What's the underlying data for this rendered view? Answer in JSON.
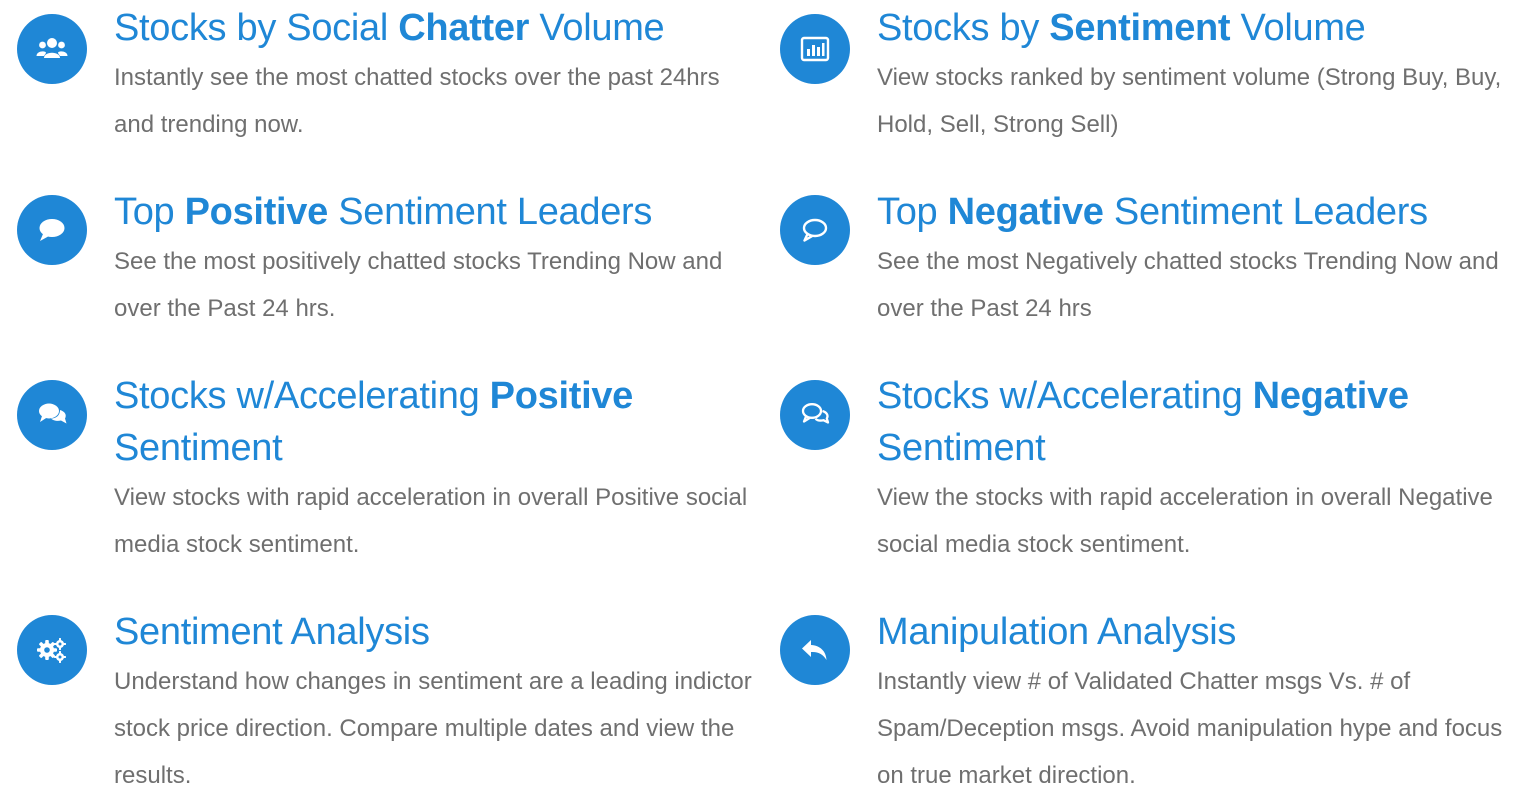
{
  "colors": {
    "accent": "#1f87d6",
    "body_text": "#6f6f6f"
  },
  "features": [
    {
      "icon": "users-icon",
      "title_pre": "Stocks by Social ",
      "title_bold": "Chatter",
      "title_post": " Volume",
      "description": "Instantly see the most chatted stocks over the past 24hrs and trending now."
    },
    {
      "icon": "bar-chart-icon",
      "title_pre": "Stocks by ",
      "title_bold": "Sentiment",
      "title_post": " Volume",
      "description": "View stocks ranked by sentiment volume (Strong Buy, Buy, Hold, Sell, Strong Sell)"
    },
    {
      "icon": "comment-icon",
      "title_pre": "Top ",
      "title_bold": "Positive",
      "title_post": " Sentiment Leaders",
      "description": "See the most positively chatted stocks Trending Now and over the Past 24 hrs."
    },
    {
      "icon": "comment-outline-icon",
      "title_pre": "Top ",
      "title_bold": "Negative",
      "title_post": " Sentiment Leaders",
      "description": "See the most Negatively chatted stocks Trending Now and over the Past 24 hrs"
    },
    {
      "icon": "comments-icon",
      "title_pre": "Stocks w/Accelerating ",
      "title_bold": "Positive",
      "title_post": " Sentiment",
      "description": "View stocks with rapid acceleration in overall Positive social media stock sentiment."
    },
    {
      "icon": "comments-outline-icon",
      "title_pre": "Stocks w/Accelerating ",
      "title_bold": "Negative",
      "title_post": " Sentiment",
      "description": "View the stocks with rapid acceleration in overall Negative social media stock sentiment."
    },
    {
      "icon": "gears-icon",
      "title_pre": "Sentiment Analysis",
      "title_bold": "",
      "title_post": "",
      "description": "Understand how changes in sentiment are a leading indictor stock price direction. Compare multiple dates and view the results."
    },
    {
      "icon": "reply-icon",
      "title_pre": "Manipulation Analysis",
      "title_bold": "",
      "title_post": "",
      "description": "Instantly view # of Validated Chatter msgs Vs. # of Spam/Deception msgs. Avoid manipulation hype and focus on true market direction."
    }
  ]
}
